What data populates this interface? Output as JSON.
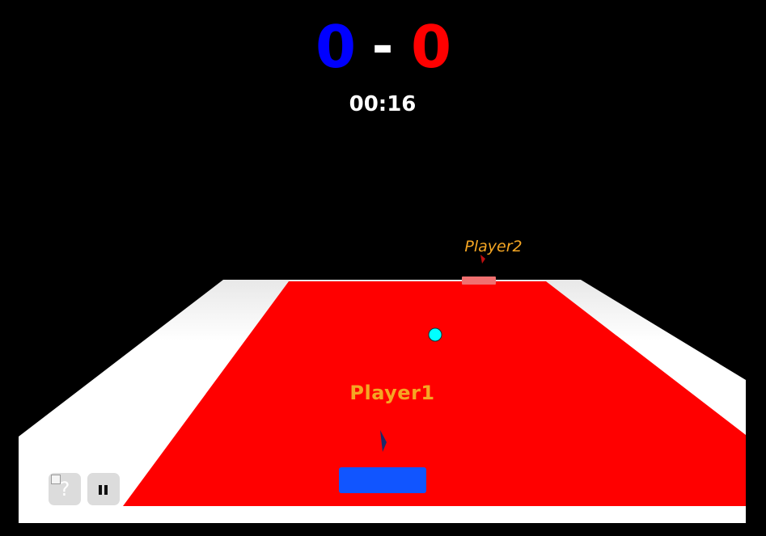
{
  "scoreboard": {
    "left_score": "0",
    "separator": "-",
    "right_score": "0",
    "left_color": "#0000ff",
    "right_color": "#ff0000",
    "timer": "00:16"
  },
  "players": {
    "player1": {
      "label": "Player1",
      "paddle_color": "#1155ff",
      "label_color": "#f5a623"
    },
    "player2": {
      "label": "Player2",
      "paddle_color": "#f07070",
      "label_color": "#f5a623"
    }
  },
  "field": {
    "court_color": "#ff0000",
    "border_color": "#ffffff",
    "background_color": "#000000"
  },
  "ball": {
    "color": "#00ffff"
  },
  "controls": {
    "help_icon": "question-mark-icon",
    "help_glyph": "?",
    "pause_icon": "pause-icon"
  }
}
